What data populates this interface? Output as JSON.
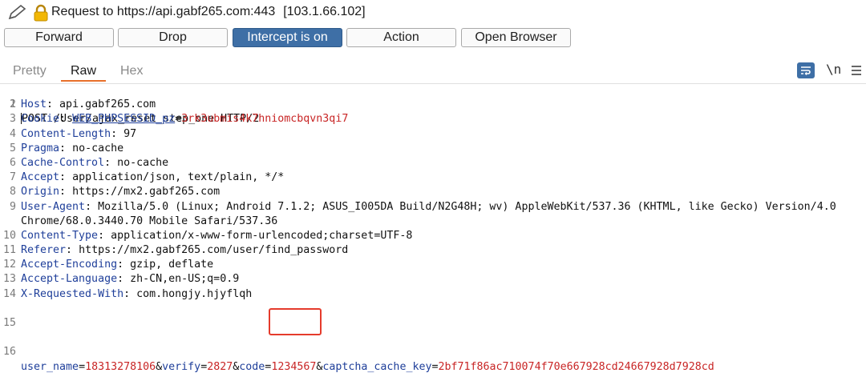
{
  "titlebar": {
    "pencil_icon": "pencil-icon",
    "lock_icon": "lock-icon",
    "title": "Request to https://api.gabf265.com:443",
    "ip": "[103.1.66.102]"
  },
  "toolbar": {
    "forward": "Forward",
    "drop": "Drop",
    "intercept": "Intercept is on",
    "action": "Action",
    "open_browser": "Open Browser"
  },
  "tabs": {
    "pretty": "Pretty",
    "raw": "Raw",
    "hex": "Hex",
    "active": "Raw"
  },
  "editor_icons": {
    "wrap": "word-wrap-icon",
    "newline": "\\n",
    "menu": "menu-icon"
  },
  "colors": {
    "accent": "#3e6fa6",
    "tab_underline": "#e8702a",
    "header_name": "#1f3f9a",
    "param_value": "#c82525",
    "highlight": "#e53b2c"
  },
  "request": {
    "line1": "POST /User/ajax_reset_step_one HTTP/2",
    "headers": [
      {
        "n": "2",
        "name": "Host",
        "value": " api.gabf265.com"
      },
      {
        "n": "3",
        "name": "Cookie",
        "cookie_name": "WEB_PHPSESSID_pz",
        "cookie_value": "3rk3ubmis4k7hniomcbqvn3qi7"
      },
      {
        "n": "4",
        "name": "Content-Length",
        "value": " 97"
      },
      {
        "n": "5",
        "name": "Pragma",
        "value": " no-cache"
      },
      {
        "n": "6",
        "name": "Cache-Control",
        "value": " no-cache"
      },
      {
        "n": "7",
        "name": "Accept",
        "value": " application/json, text/plain, */*"
      },
      {
        "n": "8",
        "name": "Origin",
        "value": " https://mx2.gabf265.com"
      },
      {
        "n": "9",
        "name": "User-Agent",
        "value": " Mozilla/5.0 (Linux; Android 7.1.2; ASUS_I005DA Build/N2G48H; wv) AppleWebKit/537.36 (KHTML, like Gecko) Version/4.0",
        "cont": "Chrome/68.0.3440.70 Mobile Safari/537.36"
      },
      {
        "n": "10",
        "name": "Content-Type",
        "value": " application/x-www-form-urlencoded;charset=UTF-8"
      },
      {
        "n": "11",
        "name": "Referer",
        "value": " https://mx2.gabf265.com/user/find_password"
      },
      {
        "n": "12",
        "name": "Accept-Encoding",
        "value": " gzip, deflate"
      },
      {
        "n": "13",
        "name": "Accept-Language",
        "value": " zh-CN,en-US;q=0.9"
      },
      {
        "n": "14",
        "name": "X-Requested-With",
        "value": " com.hongjy.hjyflqh"
      }
    ],
    "blank_line": "15",
    "body_line": "16",
    "body": {
      "k1": "user_name",
      "v1": "18313278106",
      "k2": "verify",
      "v2": "2827",
      "k3": "code",
      "v3": "1234567",
      "k4": "captcha_cache_key",
      "v4": "2bf71f86ac710074f70e667928cd24667928d7928cd"
    }
  }
}
